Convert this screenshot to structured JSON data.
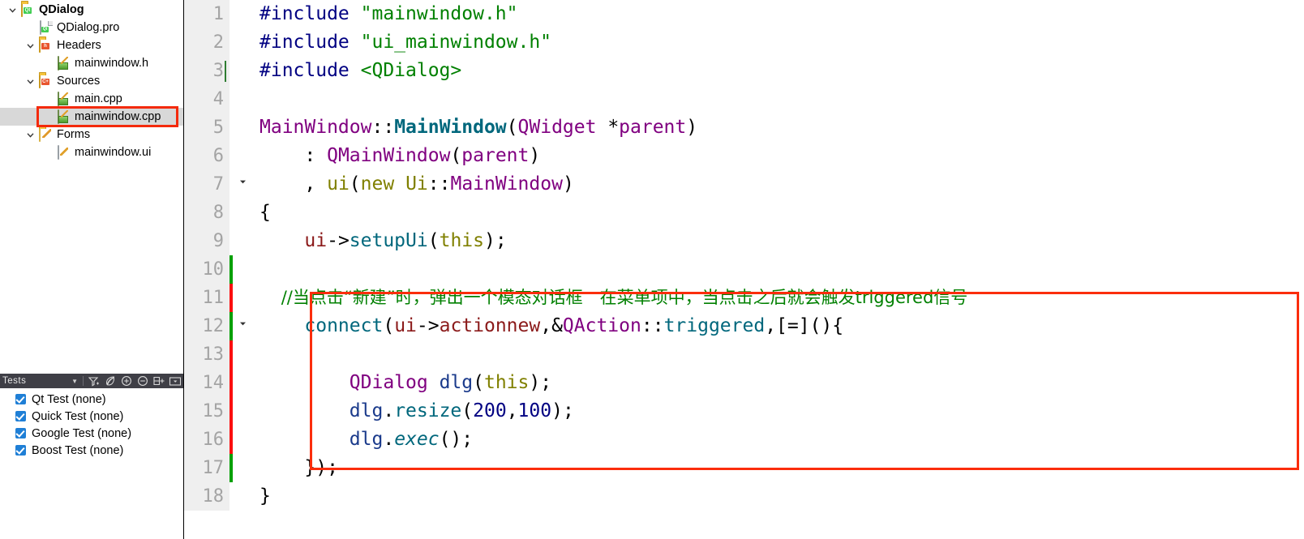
{
  "project_tree": {
    "name": "project-explorer",
    "items": [
      {
        "label": "QDialog",
        "depth": 0,
        "icon": "folder-qt-icon",
        "twisty": "chevron-down",
        "bold": true,
        "selected": false
      },
      {
        "label": "QDialog.pro",
        "depth": 1,
        "icon": "file-qt-icon",
        "twisty": "",
        "bold": false,
        "selected": false
      },
      {
        "label": "Headers",
        "depth": 1,
        "icon": "folder-headers-icon",
        "twisty": "chevron-down",
        "bold": false,
        "selected": false
      },
      {
        "label": "mainwindow.h",
        "depth": 2,
        "icon": "file-source-icon",
        "twisty": "",
        "bold": false,
        "selected": false
      },
      {
        "label": "Sources",
        "depth": 1,
        "icon": "folder-sources-icon",
        "twisty": "chevron-down",
        "bold": false,
        "selected": false
      },
      {
        "label": "main.cpp",
        "depth": 2,
        "icon": "file-source-icon",
        "twisty": "",
        "bold": false,
        "selected": false
      },
      {
        "label": "mainwindow.cpp",
        "depth": 2,
        "icon": "file-source-icon",
        "twisty": "",
        "bold": false,
        "selected": true
      },
      {
        "label": "Forms",
        "depth": 1,
        "icon": "folder-forms-icon",
        "twisty": "chevron-down",
        "bold": false,
        "selected": false
      },
      {
        "label": "mainwindow.ui",
        "depth": 2,
        "icon": "file-ui-icon",
        "twisty": "",
        "bold": false,
        "selected": false
      }
    ]
  },
  "tests_panel": {
    "title": "Tests",
    "toolbar_icons": [
      "chevron-down-icon",
      "filter-icon",
      "leaf-icon",
      "expand-all-icon",
      "collapse-all-icon",
      "add-sort-icon",
      "options-dropdown-icon"
    ],
    "items": [
      {
        "label": "Qt Test (none)",
        "checked": true
      },
      {
        "label": "Quick Test (none)",
        "checked": true
      },
      {
        "label": "Google Test (none)",
        "checked": true
      },
      {
        "label": "Boost Test (none)",
        "checked": true
      }
    ]
  },
  "editor": {
    "name": "code-editor",
    "accent_highlight_color": "#fb2d0c",
    "change_bar_added_color": "#00a000",
    "change_bar_modified_color": "#fb0f0f",
    "lines": [
      {
        "num": "1",
        "change": "none",
        "fold": "",
        "tokens": [
          {
            "t": "#include ",
            "c": "t-pre"
          },
          {
            "t": "\"mainwindow.h\"",
            "c": "t-str"
          }
        ]
      },
      {
        "num": "2",
        "change": "none",
        "fold": "",
        "tokens": [
          {
            "t": "#include ",
            "c": "t-pre"
          },
          {
            "t": "\"ui_mainwindow.h\"",
            "c": "t-str"
          }
        ]
      },
      {
        "num": "3",
        "change": "none",
        "fold": "",
        "caret": true,
        "tokens": [
          {
            "t": "#include ",
            "c": "t-pre"
          },
          {
            "t": "<QDialog>",
            "c": "t-str"
          }
        ]
      },
      {
        "num": "4",
        "change": "none",
        "fold": "",
        "tokens": []
      },
      {
        "num": "5",
        "change": "none",
        "fold": "",
        "tokens": [
          {
            "t": "MainWindow",
            "c": "t-cls"
          },
          {
            "t": "::",
            "c": "t-op"
          },
          {
            "t": "MainWindow",
            "c": "t-fn"
          },
          {
            "t": "(",
            "c": "t-op"
          },
          {
            "t": "QWidget",
            "c": "t-cls"
          },
          {
            "t": " *",
            "c": "t-op"
          },
          {
            "t": "parent",
            "c": "t-cls"
          },
          {
            "t": ")",
            "c": "t-op"
          }
        ]
      },
      {
        "num": "6",
        "change": "none",
        "fold": "",
        "tokens": [
          {
            "t": "    : ",
            "c": "t-op"
          },
          {
            "t": "QMainWindow",
            "c": "t-cls"
          },
          {
            "t": "(",
            "c": "t-op"
          },
          {
            "t": "parent",
            "c": "t-cls"
          },
          {
            "t": ")",
            "c": "t-op"
          }
        ]
      },
      {
        "num": "7",
        "change": "none",
        "fold": "chevron-down",
        "tokens": [
          {
            "t": "    , ",
            "c": "t-op"
          },
          {
            "t": "ui",
            "c": "t-kw"
          },
          {
            "t": "(",
            "c": "t-op"
          },
          {
            "t": "new",
            "c": "t-kw"
          },
          {
            "t": " ",
            "c": "t-op"
          },
          {
            "t": "Ui",
            "c": "t-kw"
          },
          {
            "t": "::",
            "c": "t-op"
          },
          {
            "t": "MainWindow",
            "c": "t-cls"
          },
          {
            "t": ")",
            "c": "t-op"
          }
        ]
      },
      {
        "num": "8",
        "change": "none",
        "fold": "",
        "tokens": [
          {
            "t": "{",
            "c": "t-plain"
          }
        ]
      },
      {
        "num": "9",
        "change": "none",
        "fold": "",
        "tokens": [
          {
            "t": "    ",
            "c": "t-op"
          },
          {
            "t": "ui",
            "c": "t-mem"
          },
          {
            "t": "->",
            "c": "t-op"
          },
          {
            "t": "setupUi",
            "c": "t-fn2"
          },
          {
            "t": "(",
            "c": "t-op"
          },
          {
            "t": "this",
            "c": "t-kw"
          },
          {
            "t": ");",
            "c": "t-op"
          }
        ]
      },
      {
        "num": "10",
        "change": "green",
        "fold": "",
        "tokens": []
      },
      {
        "num": "11",
        "change": "red",
        "fold": "",
        "tokens": [
          {
            "t": "    //当点击“新建”时，弹出一个模态对话框　在菜单项中，当点击之后就会触发triggered信号",
            "c": "t-cmt cmt-cjk"
          }
        ]
      },
      {
        "num": "12",
        "change": "green",
        "fold": "chevron-down",
        "tokens": [
          {
            "t": "    ",
            "c": "t-op"
          },
          {
            "t": "connect",
            "c": "t-fn2"
          },
          {
            "t": "(",
            "c": "t-op"
          },
          {
            "t": "ui",
            "c": "t-mem"
          },
          {
            "t": "->",
            "c": "t-op"
          },
          {
            "t": "actionnew",
            "c": "t-mem"
          },
          {
            "t": ",&",
            "c": "t-op"
          },
          {
            "t": "QAction",
            "c": "t-cls"
          },
          {
            "t": "::",
            "c": "t-op"
          },
          {
            "t": "triggered",
            "c": "t-fn2"
          },
          {
            "t": ",[=](){",
            "c": "t-op"
          }
        ]
      },
      {
        "num": "13",
        "change": "red",
        "fold": "",
        "tokens": []
      },
      {
        "num": "14",
        "change": "red",
        "fold": "",
        "tokens": [
          {
            "t": "        ",
            "c": "t-op"
          },
          {
            "t": "QDialog",
            "c": "t-cls"
          },
          {
            "t": " ",
            "c": "t-op"
          },
          {
            "t": "dlg",
            "c": "t-var"
          },
          {
            "t": "(",
            "c": "t-op"
          },
          {
            "t": "this",
            "c": "t-kw"
          },
          {
            "t": ");",
            "c": "t-op"
          }
        ]
      },
      {
        "num": "15",
        "change": "red",
        "fold": "",
        "tokens": [
          {
            "t": "        ",
            "c": "t-op"
          },
          {
            "t": "dlg",
            "c": "t-var"
          },
          {
            "t": ".",
            "c": "t-op"
          },
          {
            "t": "resize",
            "c": "t-fn2"
          },
          {
            "t": "(",
            "c": "t-op"
          },
          {
            "t": "200",
            "c": "t-num"
          },
          {
            "t": ",",
            "c": "t-op"
          },
          {
            "t": "100",
            "c": "t-num"
          },
          {
            "t": ");",
            "c": "t-op"
          }
        ]
      },
      {
        "num": "16",
        "change": "red",
        "fold": "",
        "tokens": [
          {
            "t": "        ",
            "c": "t-op"
          },
          {
            "t": "dlg",
            "c": "t-var"
          },
          {
            "t": ".",
            "c": "t-op"
          },
          {
            "t": "exec",
            "c": "t-fni"
          },
          {
            "t": "();",
            "c": "t-op"
          }
        ]
      },
      {
        "num": "17",
        "change": "green",
        "fold": "",
        "tokens": [
          {
            "t": "    });",
            "c": "t-op"
          }
        ]
      },
      {
        "num": "18",
        "change": "none",
        "fold": "",
        "tokens": [
          {
            "t": "}",
            "c": "t-plain"
          }
        ]
      }
    ]
  }
}
